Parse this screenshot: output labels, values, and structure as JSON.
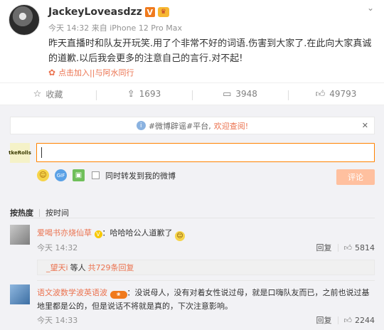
{
  "post": {
    "username": "JackeyLoveasdzz",
    "verified_badge": "V",
    "meta": "今天 14:32 来自 iPhone 12 Pro Max",
    "content": "昨天直播时和队友开玩笑.用了个非常不好的词语.伤害到大家了.在此向大家真诚的道歉.以后我会更多的注意自己的言行.对不起!",
    "supertopic": "点击加入||与阿水同行"
  },
  "actions": {
    "favorite": "收藏",
    "repost": "1693",
    "comment": "3948",
    "like": "49793"
  },
  "notice": {
    "prefix": "#微博辟谣#平台,",
    "highlight": "欢迎查阅!"
  },
  "composer": {
    "my_avatar_text": "tkeRolls",
    "repost_option": "同时转发到我的微博",
    "submit_label": "评论"
  },
  "sort": {
    "hot": "按热度",
    "time": "按时间"
  },
  "comments": [
    {
      "user": "爱喝书亦烧仙草",
      "text": "：哈哈哈公人道歉了",
      "time": "今天 14:32",
      "reply_label": "回复",
      "likes": "5814",
      "sub_reply_user": "_望天i",
      "sub_reply_text": "等人",
      "sub_reply_more": "共729条回复"
    },
    {
      "user": "语文波数学波英语波",
      "text": "：没说母人，没有对着女性说过母，就是口嗨队友而已，之前也说过基地里都是公的，但是说话不将就是真的，下次注意影响。",
      "time": "今天 14:33",
      "reply_label": "回复",
      "likes": "2244"
    }
  ],
  "colors": {
    "accent": "#eb7350",
    "input_border": "#ff8200",
    "submit_bg": "#ffc09f"
  }
}
